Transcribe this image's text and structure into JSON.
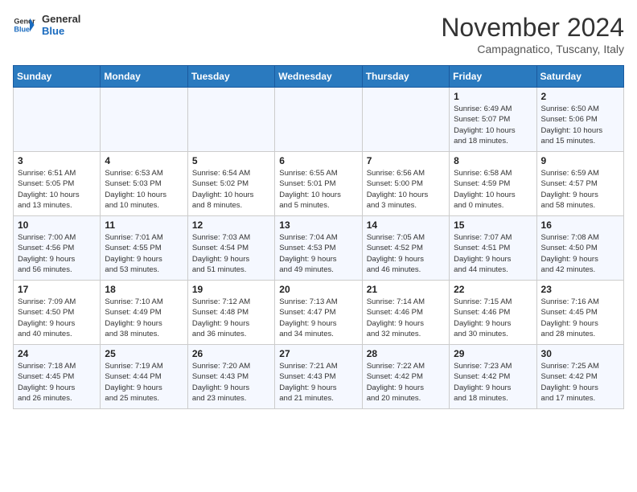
{
  "header": {
    "logo_line1": "General",
    "logo_line2": "Blue",
    "month": "November 2024",
    "location": "Campagnatico, Tuscany, Italy"
  },
  "weekdays": [
    "Sunday",
    "Monday",
    "Tuesday",
    "Wednesday",
    "Thursday",
    "Friday",
    "Saturday"
  ],
  "weeks": [
    [
      {
        "day": "",
        "info": ""
      },
      {
        "day": "",
        "info": ""
      },
      {
        "day": "",
        "info": ""
      },
      {
        "day": "",
        "info": ""
      },
      {
        "day": "",
        "info": ""
      },
      {
        "day": "1",
        "info": "Sunrise: 6:49 AM\nSunset: 5:07 PM\nDaylight: 10 hours\nand 18 minutes."
      },
      {
        "day": "2",
        "info": "Sunrise: 6:50 AM\nSunset: 5:06 PM\nDaylight: 10 hours\nand 15 minutes."
      }
    ],
    [
      {
        "day": "3",
        "info": "Sunrise: 6:51 AM\nSunset: 5:05 PM\nDaylight: 10 hours\nand 13 minutes."
      },
      {
        "day": "4",
        "info": "Sunrise: 6:53 AM\nSunset: 5:03 PM\nDaylight: 10 hours\nand 10 minutes."
      },
      {
        "day": "5",
        "info": "Sunrise: 6:54 AM\nSunset: 5:02 PM\nDaylight: 10 hours\nand 8 minutes."
      },
      {
        "day": "6",
        "info": "Sunrise: 6:55 AM\nSunset: 5:01 PM\nDaylight: 10 hours\nand 5 minutes."
      },
      {
        "day": "7",
        "info": "Sunrise: 6:56 AM\nSunset: 5:00 PM\nDaylight: 10 hours\nand 3 minutes."
      },
      {
        "day": "8",
        "info": "Sunrise: 6:58 AM\nSunset: 4:59 PM\nDaylight: 10 hours\nand 0 minutes."
      },
      {
        "day": "9",
        "info": "Sunrise: 6:59 AM\nSunset: 4:57 PM\nDaylight: 9 hours\nand 58 minutes."
      }
    ],
    [
      {
        "day": "10",
        "info": "Sunrise: 7:00 AM\nSunset: 4:56 PM\nDaylight: 9 hours\nand 56 minutes."
      },
      {
        "day": "11",
        "info": "Sunrise: 7:01 AM\nSunset: 4:55 PM\nDaylight: 9 hours\nand 53 minutes."
      },
      {
        "day": "12",
        "info": "Sunrise: 7:03 AM\nSunset: 4:54 PM\nDaylight: 9 hours\nand 51 minutes."
      },
      {
        "day": "13",
        "info": "Sunrise: 7:04 AM\nSunset: 4:53 PM\nDaylight: 9 hours\nand 49 minutes."
      },
      {
        "day": "14",
        "info": "Sunrise: 7:05 AM\nSunset: 4:52 PM\nDaylight: 9 hours\nand 46 minutes."
      },
      {
        "day": "15",
        "info": "Sunrise: 7:07 AM\nSunset: 4:51 PM\nDaylight: 9 hours\nand 44 minutes."
      },
      {
        "day": "16",
        "info": "Sunrise: 7:08 AM\nSunset: 4:50 PM\nDaylight: 9 hours\nand 42 minutes."
      }
    ],
    [
      {
        "day": "17",
        "info": "Sunrise: 7:09 AM\nSunset: 4:50 PM\nDaylight: 9 hours\nand 40 minutes."
      },
      {
        "day": "18",
        "info": "Sunrise: 7:10 AM\nSunset: 4:49 PM\nDaylight: 9 hours\nand 38 minutes."
      },
      {
        "day": "19",
        "info": "Sunrise: 7:12 AM\nSunset: 4:48 PM\nDaylight: 9 hours\nand 36 minutes."
      },
      {
        "day": "20",
        "info": "Sunrise: 7:13 AM\nSunset: 4:47 PM\nDaylight: 9 hours\nand 34 minutes."
      },
      {
        "day": "21",
        "info": "Sunrise: 7:14 AM\nSunset: 4:46 PM\nDaylight: 9 hours\nand 32 minutes."
      },
      {
        "day": "22",
        "info": "Sunrise: 7:15 AM\nSunset: 4:46 PM\nDaylight: 9 hours\nand 30 minutes."
      },
      {
        "day": "23",
        "info": "Sunrise: 7:16 AM\nSunset: 4:45 PM\nDaylight: 9 hours\nand 28 minutes."
      }
    ],
    [
      {
        "day": "24",
        "info": "Sunrise: 7:18 AM\nSunset: 4:45 PM\nDaylight: 9 hours\nand 26 minutes."
      },
      {
        "day": "25",
        "info": "Sunrise: 7:19 AM\nSunset: 4:44 PM\nDaylight: 9 hours\nand 25 minutes."
      },
      {
        "day": "26",
        "info": "Sunrise: 7:20 AM\nSunset: 4:43 PM\nDaylight: 9 hours\nand 23 minutes."
      },
      {
        "day": "27",
        "info": "Sunrise: 7:21 AM\nSunset: 4:43 PM\nDaylight: 9 hours\nand 21 minutes."
      },
      {
        "day": "28",
        "info": "Sunrise: 7:22 AM\nSunset: 4:42 PM\nDaylight: 9 hours\nand 20 minutes."
      },
      {
        "day": "29",
        "info": "Sunrise: 7:23 AM\nSunset: 4:42 PM\nDaylight: 9 hours\nand 18 minutes."
      },
      {
        "day": "30",
        "info": "Sunrise: 7:25 AM\nSunset: 4:42 PM\nDaylight: 9 hours\nand 17 minutes."
      }
    ]
  ]
}
